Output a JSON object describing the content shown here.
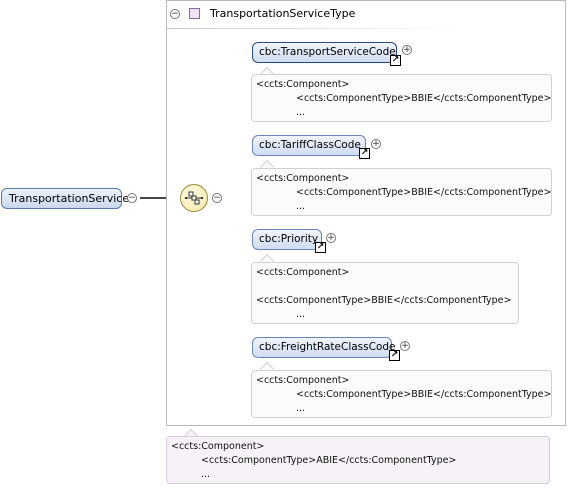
{
  "diagram": {
    "root_element": {
      "label": "TransportationService"
    },
    "type_box": {
      "label": "TransportationServiceType"
    },
    "type_annotation": {
      "line1": "<ccts:Component>",
      "line2": "<ccts:ComponentType>ABIE</ccts:ComponentType>",
      "line3": "..."
    },
    "children": [
      {
        "label": "cbc:TransportServiceCode",
        "annotation": {
          "line1": "<ccts:Component>",
          "line2": "<ccts:ComponentType>BBIE</ccts:ComponentType>",
          "line3": "..."
        }
      },
      {
        "label": "cbc:TariffClassCode",
        "annotation": {
          "line1": "<ccts:Component>",
          "line2": "<ccts:ComponentType>BBIE</ccts:ComponentType>",
          "line3": "..."
        }
      },
      {
        "label": "cbc:Priority",
        "annotation": {
          "line1": "<ccts:Component>",
          "line2": "<ccts:ComponentType>BBIE</ccts:ComponentType>",
          "line3": "..."
        }
      },
      {
        "label": "cbc:FreightRateClassCode",
        "annotation": {
          "line1": "<ccts:Component>",
          "line2": "<ccts:ComponentType>BBIE</ccts:ComponentType>",
          "line3": "..."
        }
      }
    ],
    "symbols": {
      "collapse": "−",
      "expand": "+",
      "link": "↗"
    }
  }
}
